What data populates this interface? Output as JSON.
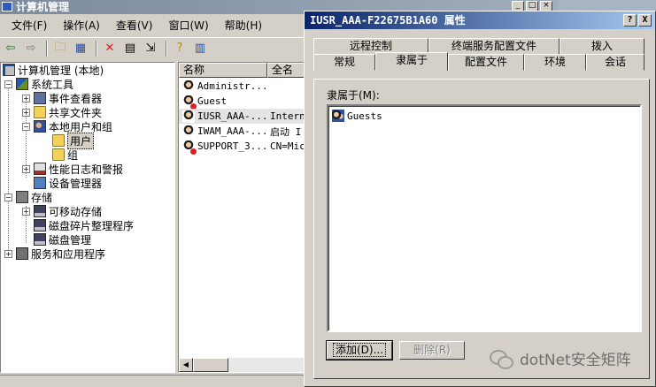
{
  "main_window": {
    "title": "计算机管理",
    "menu": [
      "文件(F)",
      "操作(A)",
      "查看(V)",
      "窗口(W)",
      "帮助(H)"
    ]
  },
  "toolbar": {
    "icons": [
      "back-icon",
      "forward-icon",
      "up-folder-icon",
      "show-tree-icon",
      "delete-icon",
      "properties-icon",
      "export-icon",
      "help-icon",
      "show-pane-icon"
    ]
  },
  "tree": {
    "root": "计算机管理 (本地)",
    "system_tools": "系统工具",
    "event_viewer": "事件查看器",
    "shared_folders": "共享文件夹",
    "local_users": "本地用户和组",
    "users": "用户",
    "groups": "组",
    "perf_logs": "性能日志和警报",
    "device_manager": "设备管理器",
    "storage": "存储",
    "removable_storage": "可移动存储",
    "defrag": "磁盘碎片整理程序",
    "disk_mgmt": "磁盘管理",
    "services": "服务和应用程序"
  },
  "list": {
    "col_name": "名称",
    "col_fullname": "全名",
    "rows": [
      {
        "name": "Administr...",
        "desc": "",
        "disabled": false,
        "selected": false
      },
      {
        "name": "Guest",
        "desc": "",
        "disabled": true,
        "selected": false
      },
      {
        "name": "IUSR_AAA-...",
        "desc": "Intern",
        "disabled": false,
        "selected": true
      },
      {
        "name": "IWAM_AAA-...",
        "desc": "启动 I",
        "disabled": false,
        "selected": false
      },
      {
        "name": "SUPPORT_3...",
        "desc": "CN=Mic",
        "disabled": true,
        "selected": false
      }
    ]
  },
  "dialog": {
    "title": "IUSR_AAA-F22675B1A60 属性",
    "help_btn": "?",
    "close_btn": "X",
    "tabs_row1": [
      "远程控制",
      "终端服务配置文件",
      "拨入"
    ],
    "tabs_row2": [
      "常规",
      "隶属于",
      "配置文件",
      "环境",
      "会话"
    ],
    "active_tab": "隶属于",
    "member_of_label": "隶属于(M):",
    "members": [
      "Guests"
    ],
    "add_button": "添加(D)...",
    "remove_button": "删除(R)"
  },
  "watermark": "dotNet安全矩阵"
}
